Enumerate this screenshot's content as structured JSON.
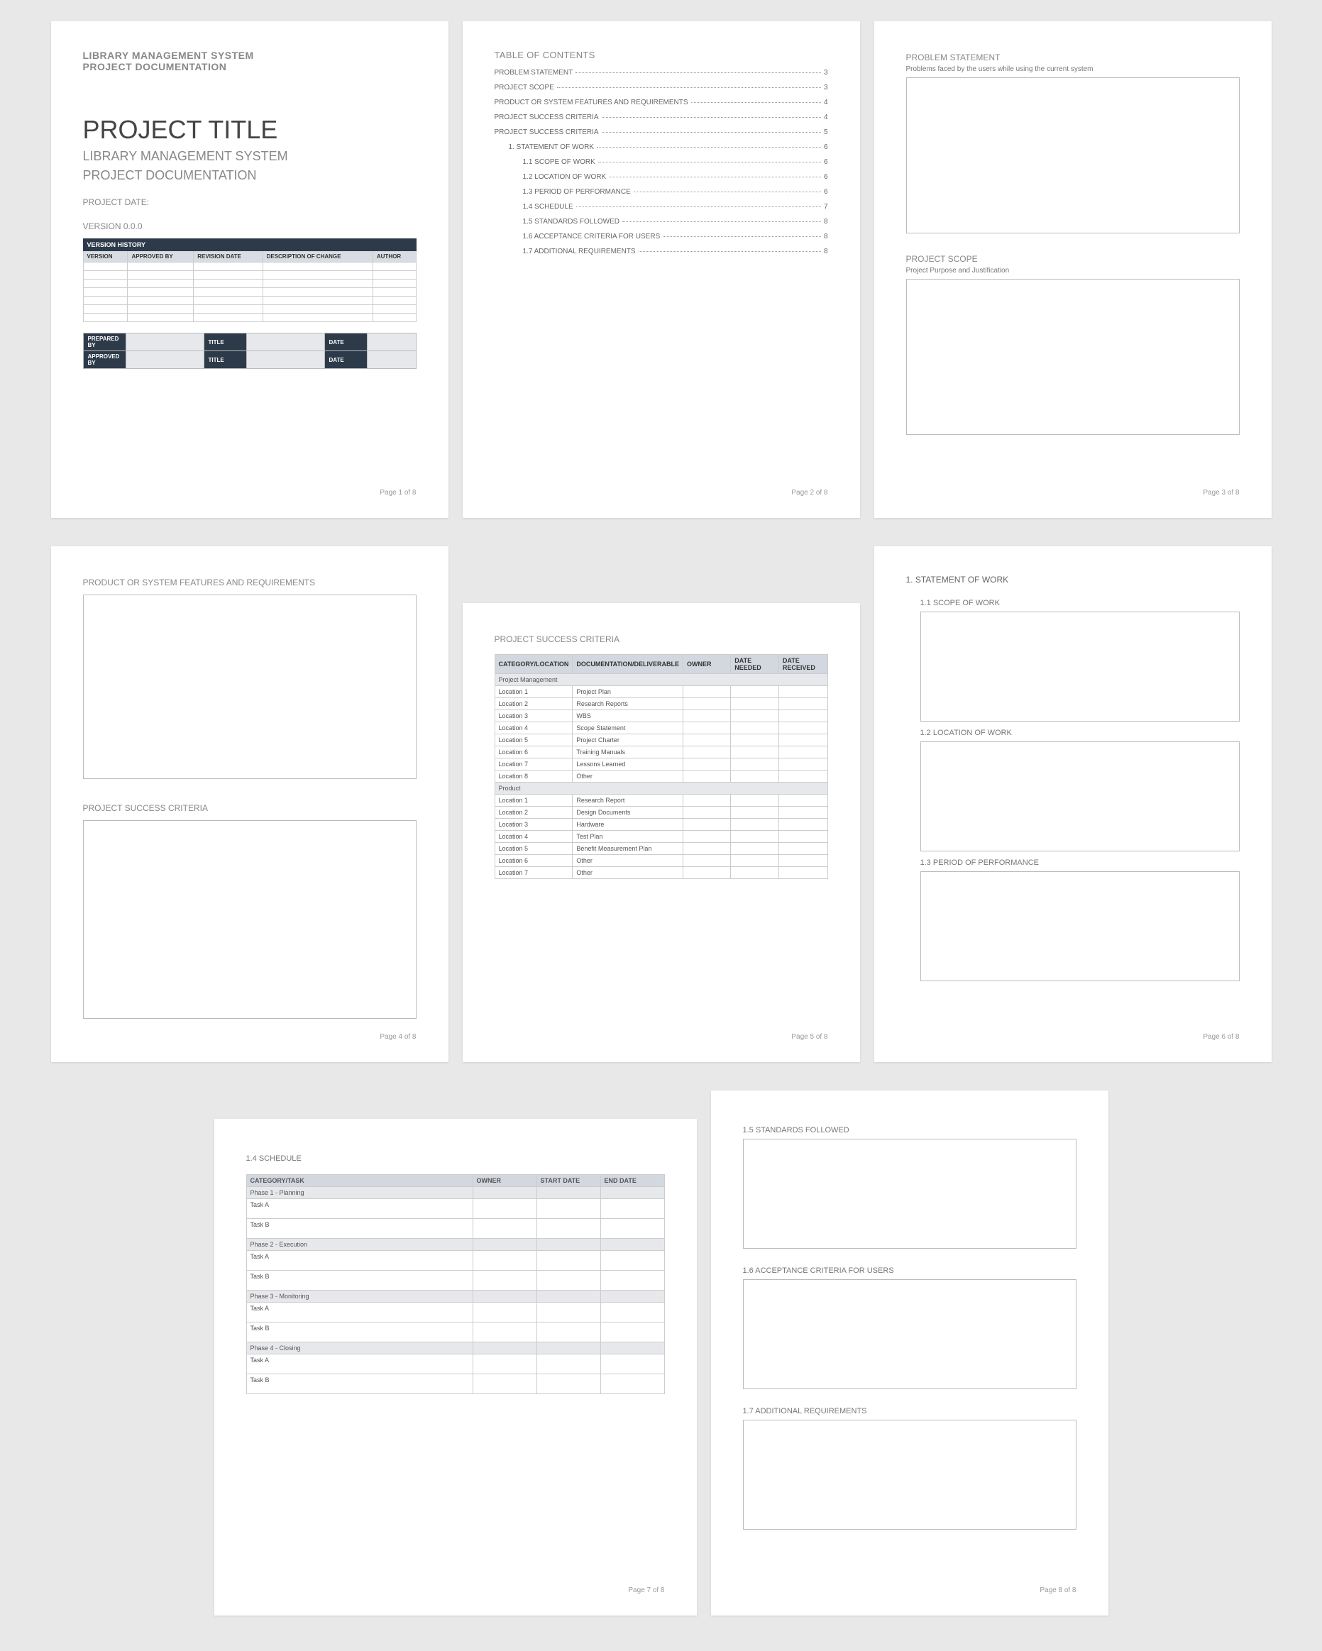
{
  "page1": {
    "header1": "LIBRARY MANAGEMENT SYSTEM",
    "header2": "PROJECT DOCUMENTATION",
    "title": "PROJECT TITLE",
    "subtitle1": "LIBRARY MANAGEMENT SYSTEM",
    "subtitle2": "PROJECT DOCUMENTATION",
    "date_label": "PROJECT DATE:",
    "version_label": "VERSION 0.0.0",
    "version_history_title": "VERSION HISTORY",
    "vh_cols": {
      "c1": "VERSION",
      "c2": "APPROVED BY",
      "c3": "REVISION DATE",
      "c4": "DESCRIPTION OF CHANGE",
      "c5": "AUTHOR"
    },
    "sign": {
      "prepared": "PREPARED BY",
      "approved": "APPROVED BY",
      "title": "TITLE",
      "date": "DATE"
    },
    "footer": "Page 1 of 8"
  },
  "page2": {
    "heading": "TABLE OF CONTENTS",
    "items": [
      {
        "label": "PROBLEM STATEMENT",
        "pg": "3",
        "indent": 0
      },
      {
        "label": "PROJECT SCOPE",
        "pg": "3",
        "indent": 0
      },
      {
        "label": "PRODUCT OR SYSTEM FEATURES AND REQUIREMENTS",
        "pg": "4",
        "indent": 0
      },
      {
        "label": "PROJECT SUCCESS CRITERIA",
        "pg": "4",
        "indent": 0
      },
      {
        "label": "PROJECT SUCCESS CRITERIA",
        "pg": "5",
        "indent": 0
      },
      {
        "label": "1.    STATEMENT OF WORK",
        "pg": "6",
        "indent": 1
      },
      {
        "label": "1.1    SCOPE OF WORK",
        "pg": "6",
        "indent": 2
      },
      {
        "label": "1.2    LOCATION OF WORK",
        "pg": "6",
        "indent": 2
      },
      {
        "label": "1.3    PERIOD OF PERFORMANCE",
        "pg": "6",
        "indent": 2
      },
      {
        "label": "1.4    SCHEDULE",
        "pg": "7",
        "indent": 2
      },
      {
        "label": "1.5    STANDARDS FOLLOWED",
        "pg": "8",
        "indent": 2
      },
      {
        "label": "1.6    ACCEPTANCE CRITERIA FOR USERS",
        "pg": "8",
        "indent": 2
      },
      {
        "label": "1.7    ADDITIONAL REQUIREMENTS",
        "pg": "8",
        "indent": 2
      }
    ],
    "footer": "Page 2 of 8"
  },
  "page3": {
    "h1": "PROBLEM STATEMENT",
    "sub1": "Problems faced by the users while using the current system",
    "h2": "PROJECT SCOPE",
    "sub2": "Project Purpose and Justification",
    "footer": "Page 3 of 8"
  },
  "page4": {
    "h1": "PRODUCT OR SYSTEM FEATURES AND REQUIREMENTS",
    "h2": "PROJECT SUCCESS CRITERIA",
    "footer": "Page 4 of 8"
  },
  "page5": {
    "heading": "PROJECT SUCCESS CRITERIA",
    "cols": {
      "c1": "CATEGORY/LOCATION",
      "c2": "DOCUMENTATION/DELIVERABLE",
      "c3": "OWNER",
      "c4": "DATE NEEDED",
      "c5": "DATE RECEIVED"
    },
    "group1": "Project Management",
    "rows1": [
      {
        "loc": "Location 1",
        "doc": "Project Plan"
      },
      {
        "loc": "Location 2",
        "doc": "Research Reports"
      },
      {
        "loc": "Location 3",
        "doc": "WBS"
      },
      {
        "loc": "Location 4",
        "doc": "Scope Statement"
      },
      {
        "loc": "Location 5",
        "doc": "Project Charter"
      },
      {
        "loc": "Location 6",
        "doc": "Training Manuals"
      },
      {
        "loc": "Location 7",
        "doc": "Lessons Learned"
      },
      {
        "loc": "Location 8",
        "doc": "Other"
      }
    ],
    "group2": "Product",
    "rows2": [
      {
        "loc": "Location 1",
        "doc": "Research Report"
      },
      {
        "loc": "Location 2",
        "doc": "Design Documents"
      },
      {
        "loc": "Location 3",
        "doc": "Hardware"
      },
      {
        "loc": "Location 4",
        "doc": "Test Plan"
      },
      {
        "loc": "Location 5",
        "doc": "Benefit Measurement Plan"
      },
      {
        "loc": "Location 6",
        "doc": "Other"
      },
      {
        "loc": "Location 7",
        "doc": "Other"
      }
    ],
    "footer": "Page 5 of 8"
  },
  "page6": {
    "heading": "1.  STATEMENT OF WORK",
    "s1": "1.1    SCOPE OF WORK",
    "s2": "1.2    LOCATION OF WORK",
    "s3": "1.3    PERIOD OF PERFORMANCE",
    "footer": "Page 6 of 8"
  },
  "page7": {
    "heading": "1.4    SCHEDULE",
    "cols": {
      "c1": "CATEGORY/TASK",
      "c2": "OWNER",
      "c3": "START DATE",
      "c4": "END DATE"
    },
    "phases": [
      {
        "name": "Phase 1 - Planning",
        "tasks": [
          "Task A",
          "Task B"
        ]
      },
      {
        "name": "Phase 2 - Execution",
        "tasks": [
          "Task A",
          "Task B"
        ]
      },
      {
        "name": "Phase 3 - Monitoring",
        "tasks": [
          "Task A",
          "Task B"
        ]
      },
      {
        "name": "Phase 4 - Closing",
        "tasks": [
          "Task A",
          "Task B"
        ]
      }
    ],
    "footer": "Page 7 of 8"
  },
  "page8": {
    "s1": "1.5    STANDARDS FOLLOWED",
    "s2": "1.6    ACCEPTANCE CRITERIA FOR USERS",
    "s3": "1.7    ADDITIONAL REQUIREMENTS",
    "footer": "Page 8 of 8"
  }
}
